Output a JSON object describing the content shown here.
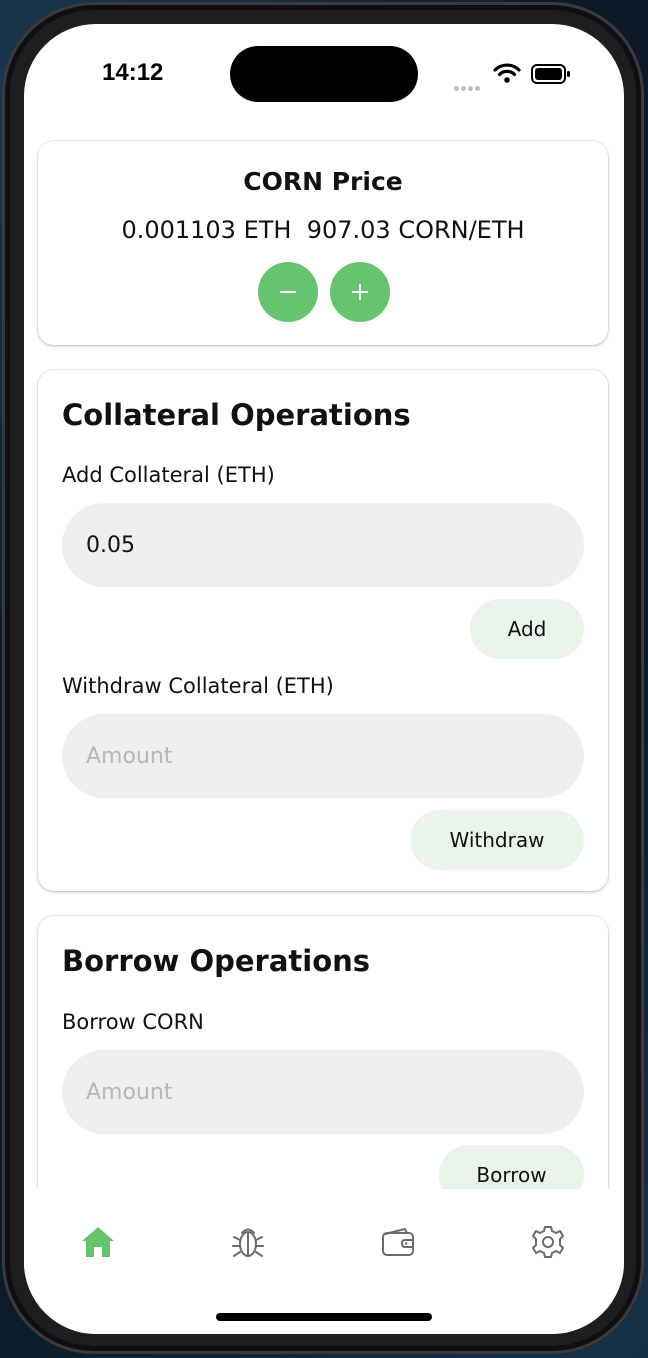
{
  "status_bar": {
    "time": "14:12"
  },
  "price_card": {
    "title": "CORN Price",
    "values": "0.001103 ETH  907.03 CORN/ETH",
    "decrease_icon": "minus-icon",
    "increase_icon": "plus-icon"
  },
  "collateral": {
    "title": "Collateral Operations",
    "add_label": "Add Collateral (ETH)",
    "add_value": "0.05",
    "add_button": "Add",
    "withdraw_label": "Withdraw Collateral (ETH)",
    "withdraw_placeholder": "Amount",
    "withdraw_button": "Withdraw"
  },
  "borrow": {
    "title": "Borrow Operations",
    "borrow_label": "Borrow CORN",
    "borrow_placeholder": "Amount",
    "borrow_button": "Borrow"
  },
  "tab_bar": {
    "items": [
      {
        "icon": "home-icon",
        "active": true
      },
      {
        "icon": "bug-icon",
        "active": false
      },
      {
        "icon": "wallet-icon",
        "active": false
      },
      {
        "icon": "settings-icon",
        "active": false
      }
    ],
    "active_color": "#66c46f",
    "inactive_color": "#6b6b6b"
  },
  "colors": {
    "accent": "#66c46f",
    "button_light": "#e9f3ea",
    "input_bg": "#eeeeee"
  }
}
